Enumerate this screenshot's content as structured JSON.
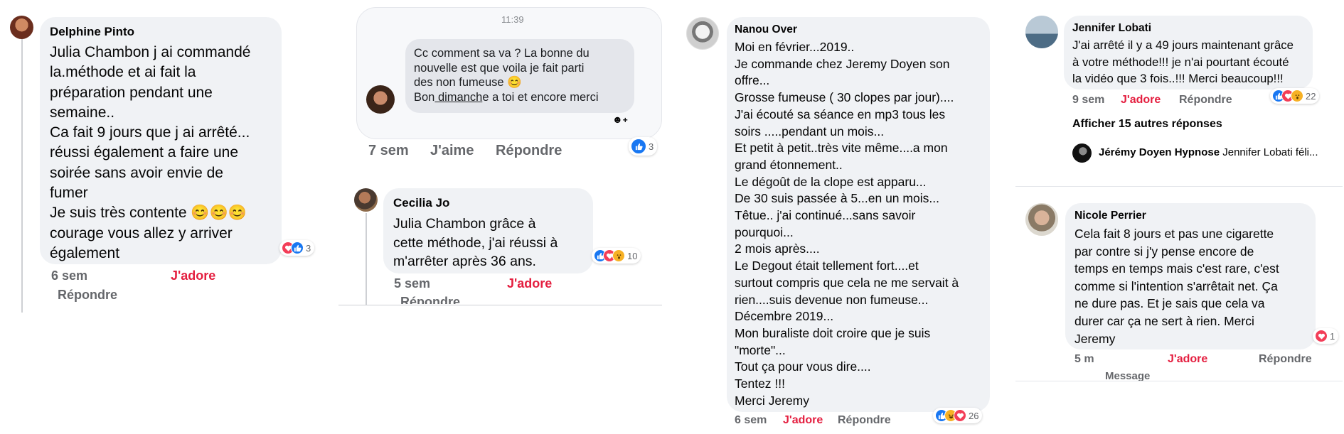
{
  "panel1": {
    "name": "Delphine Pinto",
    "text": "Julia Chambon j ai commandé\nla.méthode et ai fait la\npréparation pendant une\nsemaine..\nCa fait 9 jours que j ai arrêté...\nréussi également a faire une\nsoirée sans avoir envie de\nfumer\nJe suis très contente 😊😊😊\ncourage vous allez y arriver\négalement",
    "reaction_count": "3",
    "time": "6 sem",
    "adore": "J'adore",
    "reply": "Répondre"
  },
  "panel2": {
    "timestamp": "11:39",
    "msg_line1": "Cc  comment sa va ?   La bonne du\nnouvelle   est que voila  je fait parti\ndes non fumeuse  😊",
    "msg_bon": "Bon",
    "msg_dimanch": " dimanch",
    "msg_rest": "e a toi et encore merci",
    "seen_icon": "emoji-add-icon",
    "reaction_count": "3",
    "time": "7 sem",
    "like": "J'aime",
    "reply": "Répondre",
    "comment2": {
      "name": "Cecilia Jo",
      "text": "Julia Chambon grâce à\ncette méthode, j'ai réussi à\nm'arrêter après 36 ans.",
      "reaction_count": "10",
      "time": "5 sem",
      "adore": "J'adore",
      "reply": "Répondre"
    }
  },
  "panel3": {
    "name": "Nanou Over",
    "text": "Moi en février...2019..\nJe commande chez Jeremy  Doyen son\noffre...\nGrosse fumeuse ( 30 clopes  par jour)....\nJ'ai écouté sa séance  en mp3 tous les\nsoirs .....pendant un mois...\nEt petit à petit..très vite même....a mon\ngrand étonnement..\nLe dégoût de la clope  est apparu...\nDe 30 suis passée  à  5...en un mois...\nTêtue..  j'ai continué...sans savoir\npourquoi...\n2 mois après....\nLe Degout était  tellement  fort....et\nsurtout compris que cela  ne me servait à\nrien....suis devenue non fumeuse...\nDécembre  2019...\nMon buraliste  doit croire que je suis\n\"morte\"...\nTout ça  pour vous dire....\nTentez !!!\nMerci  Jeremy",
    "reaction_count": "26",
    "time": "6 sem",
    "adore": "J'adore",
    "reply": "Répondre"
  },
  "panel4": {
    "name": "Jennifer Lobati",
    "text": "J'ai arrêté il y a 49 jours maintenant grâce\nà votre méthode!!! je n'ai pourtant écouté\nla vidéo que 3 fois..!!! Merci beaucoup!!!",
    "reaction_count": "22",
    "time": "9 sem",
    "adore": "J'adore",
    "reply": "Répondre",
    "more_replies": "Afficher 15 autres réponses",
    "reply_preview_name": "Jérémy Doyen Hypnose",
    "reply_preview_text": " Jennifer Lobati féli...",
    "comment2": {
      "name": "Nicole Perrier",
      "text": "Cela fait 8 jours et pas une cigarette\npar contre si j'y pense encore de\ntemps en temps mais c'est rare, c'est\ncomme si l'intention s'arrêtait net. Ça\nne dure pas. Et je sais que cela va\ndurer car ça ne sert à rien. Merci\nJeremy",
      "reaction_count": "1",
      "time": "5 m",
      "adore": "J'adore",
      "reply": "Répondre",
      "message": "Message"
    }
  },
  "colors": {
    "bubble": "#f0f2f5",
    "meta": "#65676b",
    "adore": "#e41e3f",
    "like": "#1877f2",
    "love": "#f33e58",
    "wow": "#f7b125"
  }
}
